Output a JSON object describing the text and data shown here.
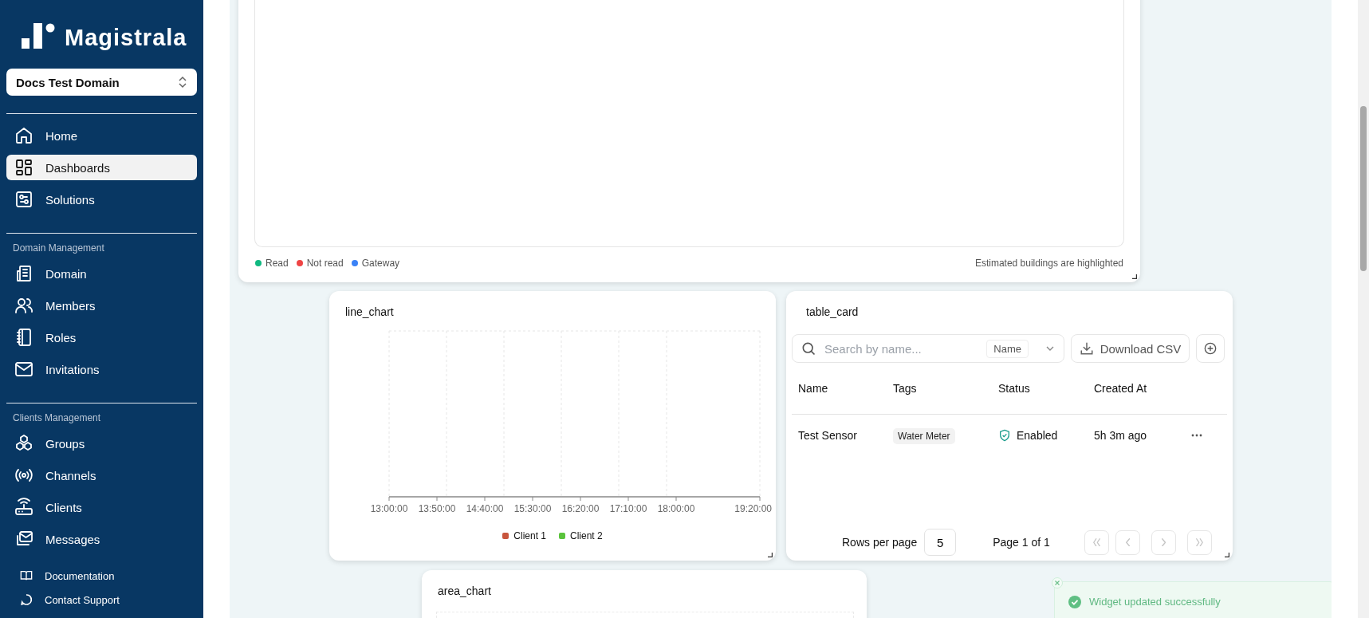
{
  "sidebar": {
    "logo_text": "Magistrala",
    "domain_selector": "Docs Test Domain",
    "sections": [
      {
        "items": [
          {
            "label": "Home",
            "selected": false
          },
          {
            "label": "Dashboards",
            "selected": true
          },
          {
            "label": "Solutions",
            "selected": false
          }
        ]
      },
      {
        "heading": "Domain Management",
        "items": [
          {
            "label": "Domain",
            "selected": false
          },
          {
            "label": "Members",
            "selected": false
          },
          {
            "label": "Roles",
            "selected": false
          },
          {
            "label": "Invitations",
            "selected": false
          }
        ]
      },
      {
        "heading": "Clients Management",
        "items": [
          {
            "label": "Groups",
            "selected": false
          },
          {
            "label": "Channels",
            "selected": false
          },
          {
            "label": "Clients",
            "selected": false
          },
          {
            "label": "Messages",
            "selected": false
          }
        ]
      }
    ],
    "footer_links": [
      "Documentation",
      "Contact Support"
    ]
  },
  "map_widget": {
    "legend": [
      {
        "label": "Read",
        "color": "#10b981"
      },
      {
        "label": "Not read",
        "color": "#ef4444"
      },
      {
        "label": "Gateway",
        "color": "#3b82f6"
      }
    ],
    "note": "Estimated buildings are highlighted"
  },
  "line_chart": {
    "title": "line_chart",
    "x_labels": [
      "13:00:00",
      "13:50:00",
      "14:40:00",
      "15:30:00",
      "16:20:00",
      "17:10:00",
      "18:00:00",
      "19:20:00"
    ],
    "legend": [
      {
        "label": "Client 1",
        "color": "#c8553d"
      },
      {
        "label": "Client 2",
        "color": "#5ac33c"
      }
    ]
  },
  "table_card": {
    "title": "table_card",
    "search_placeholder": "Search by name...",
    "filter": "Name",
    "download_button": "Download CSV",
    "columns": [
      "Name",
      "Tags",
      "Status",
      "Created At"
    ],
    "rows": [
      {
        "name": "Test Sensor",
        "tag": "Water Meter",
        "status": "Enabled",
        "created_at": "5h 3m ago"
      }
    ],
    "rows_per_page_label": "Rows per page",
    "rows_per_page": "5",
    "page_info": "Page 1 of 1",
    "pager": [
      {
        "kind": "first",
        "disabled": true
      },
      {
        "kind": "prev",
        "disabled": true
      },
      {
        "kind": "next",
        "disabled": true
      },
      {
        "kind": "last",
        "disabled": true
      }
    ]
  },
  "area_chart": {
    "title": "area_chart"
  },
  "toast": {
    "message": "Widget updated successfully"
  }
}
